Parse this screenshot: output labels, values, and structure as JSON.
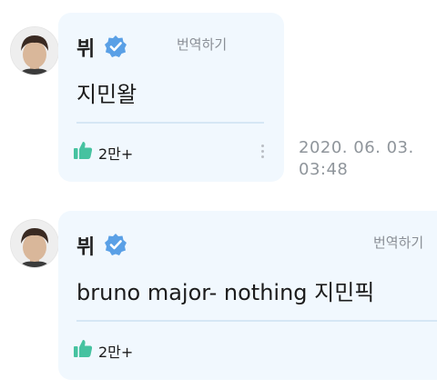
{
  "comments": [
    {
      "author": "뷔",
      "translate_label": "번역하기",
      "message": "지민왈",
      "likes": "2만+",
      "timestamp_date": "2020. 06. 03.",
      "timestamp_time": "03:48"
    },
    {
      "author": "뷔",
      "translate_label": "번역하기",
      "message": "bruno major- nothing 지민픽",
      "likes": "2만+"
    }
  ],
  "colors": {
    "bubble": "#f1f8fe",
    "verified_badge": "#5aa0e6",
    "like_icon": "#46c2a0",
    "timestamp": "#8f959b"
  },
  "icons": {
    "verified": "verified-badge-icon",
    "like": "thumbs-up-icon",
    "more": "more-vertical-icon"
  }
}
